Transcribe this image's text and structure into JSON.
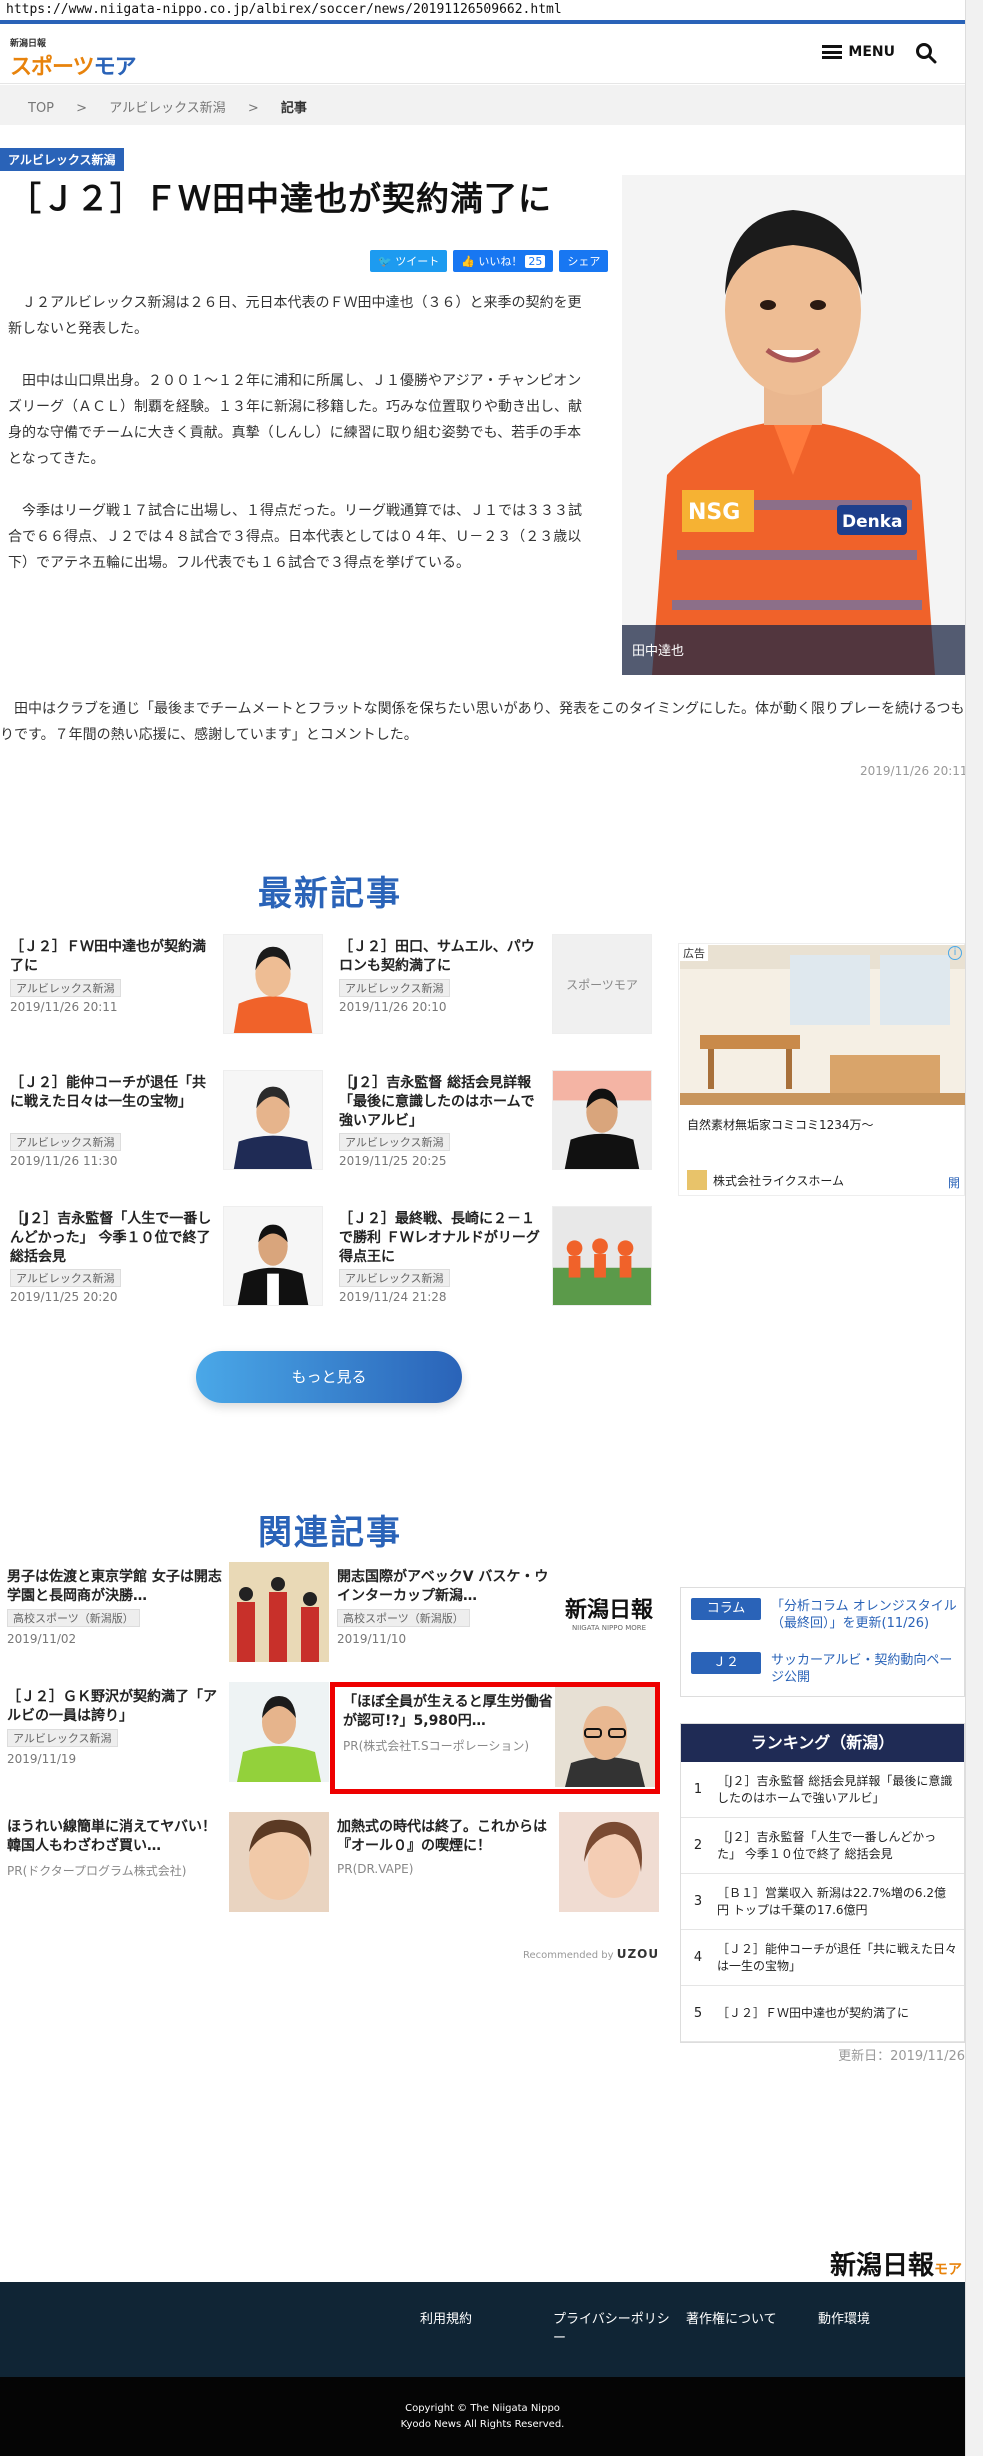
{
  "browser": {
    "url": "https://www.niigata-nippo.co.jp/albirex/soccer/news/20191126509662.html"
  },
  "site": {
    "logo_small": "新潟日報",
    "logo_big_a": "スポーツ",
    "logo_big_b": "モア",
    "menu_label": "MENU"
  },
  "breadcrumb": [
    "TOP",
    ">",
    "アルビレックス新潟",
    ">",
    "記事"
  ],
  "article": {
    "category": "アルビレックス新潟",
    "title": "［Ｊ２］ＦＷ田中達也が契約満了に",
    "share": {
      "tweet": "ツイート",
      "like": "いいね！",
      "like_count": "25",
      "share": "シェア"
    },
    "paragraphs": [
      "Ｊ２アルビレックス新潟は２６日、元日本代表のＦＷ田中達也（３６）と来季の契約を更新しないと発表した。",
      "田中は山口県出身。２００１～１２年に浦和に所属し、Ｊ１優勝やアジア・チャンピオンズリーグ（ＡＣＬ）制覇を経験。１３年に新潟に移籍した。巧みな位置取りや動き出し、献身的な守備でチームに大きく貢献。真摯（しんし）に練習に取り組む姿勢でも、若手の手本となってきた。",
      "今季はリーグ戦１７試合に出場し、１得点だった。リーグ戦通算では、Ｊ１では３３３試合で６６得点、Ｊ２では４８試合で３得点。日本代表としては０４年、Ｕ－２３（２３歳以下）でアテネ五輪に出場。フル代表でも１６試合で３得点を挙げている。"
    ],
    "last_paragraph": "田中はクラブを通じ「最後までチームメートとフラットな関係を保ちたい思いがあり、発表をこのタイミングにした。体が動く限りプレーを続けるつもりです。７年間の熱い応援に、感謝しています」とコメントした。",
    "photo_caption": "田中達也",
    "date": "2019/11/26 20:11"
  },
  "latest": {
    "heading": "最新記事",
    "items": [
      {
        "title": "［Ｊ２］ＦＷ田中達也が契約満了に",
        "tag": "アルビレックス新潟",
        "date": "2019/11/26 20:11"
      },
      {
        "title": "［Ｊ２］田口、サムエル、パウロンも契約満了に",
        "tag": "アルビレックス新潟",
        "date": "2019/11/26 20:10"
      },
      {
        "title": "［Ｊ２］能仲コーチが退任「共に戦えた日々は一生の宝物」",
        "tag": "アルビレックス新潟",
        "date": "2019/11/26 11:30"
      },
      {
        "title": "［J２］吉永監督 総括会見詳報 「最後に意識したのはホームで強いアルビ」",
        "tag": "アルビレックス新潟",
        "date": "2019/11/25 20:25"
      },
      {
        "title": "［J２］吉永監督「人生で一番しんどかった」 今季１０位で終了 総括会見",
        "tag": "アルビレックス新潟",
        "date": "2019/11/25 20:20"
      },
      {
        "title": "［Ｊ２］最終戦、長崎に２－１で勝利 ＦＷレオナルドがリーグ得点王に",
        "tag": "アルビレックス新潟",
        "date": "2019/11/24 21:28"
      }
    ],
    "more_label": "もっと見る",
    "thumb_logo": "スポーツモア"
  },
  "ad": {
    "label": "広告",
    "info": "i",
    "text": "自然素材無垢家コミコミ1234万～",
    "advertiser": "株式会社ライクスホーム",
    "open": "開"
  },
  "related": {
    "heading": "関連記事",
    "items": [
      {
        "title": "男子は佐渡と東京学館 女子は開志学園と長岡商が決勝…",
        "tag": "高校スポーツ（新潟版）",
        "date": "2019/11/02"
      },
      {
        "title": "開志国際がアベックV バスケ・ウインターカップ新潟…",
        "tag": "高校スポーツ（新潟版）",
        "date": "2019/11/10"
      },
      {
        "title": "［Ｊ２］ＧＫ野沢が契約満了「アルビの一員は誇り」",
        "tag": "アルビレックス新潟",
        "date": "2019/11/19"
      },
      {
        "title": "「ほぼ全員が生えると厚生労働省が認可!?」5,980円…",
        "pr": "PR(株式会社T.Sコーポレーション)"
      },
      {
        "title": "ほうれい線簡単に消えてヤバい！韓国人もわざわざ買い…",
        "pr": "PR(ドクタープログラム株式会社)"
      },
      {
        "title": "加熱式の時代は終了。これからは『オール０』の喫煙に！",
        "pr": "PR(DR.VAPE)"
      }
    ],
    "niigata_logo": "新潟日報",
    "niigata_sub": "NIIGATA NIPPO MORE",
    "recommended_by": "Recommended by",
    "recommended_brand": "UZOU"
  },
  "side_links": [
    {
      "badge": "コラム",
      "text": "「分析コラム オレンジスタイル（最終回）」を更新(11/26)"
    },
    {
      "badge": "Ｊ２",
      "text": "サッカーアルビ・契約動向ページ公開"
    }
  ],
  "ranking": {
    "heading": "ランキング（新潟）",
    "items": [
      {
        "n": "1",
        "text": "［J２］吉永監督 総括会見詳報「最後に意識したのはホームで強いアルビ」"
      },
      {
        "n": "2",
        "text": "［J２］吉永監督「人生で一番しんどかった」 今季１０位で終了 総括会見"
      },
      {
        "n": "3",
        "text": "［Ｂ１］営業収入 新潟は22.7%増の6.2億円 トップは千葉の17.6億円"
      },
      {
        "n": "4",
        "text": "［Ｊ２］能仲コーチが退任「共に戦えた日々は一生の宝物」"
      },
      {
        "n": "5",
        "text": "［Ｊ２］ＦＷ田中達也が契約満了に"
      }
    ],
    "updated": "更新日：2019/11/26"
  },
  "footer": {
    "logo": "新潟日報",
    "logo_sub": "モア",
    "links": [
      "利用規約",
      "プライバシーポリシー",
      "著作権について",
      "動作環境"
    ],
    "copyright1": "Copyright © The Niigata Nippo",
    "copyright2": "Kyodo News All Rights Reserved."
  },
  "colors": {
    "accent": "#2a63b8",
    "orange": "#e8830c",
    "footer": "#102535",
    "ranking_header": "#1f2b55"
  }
}
